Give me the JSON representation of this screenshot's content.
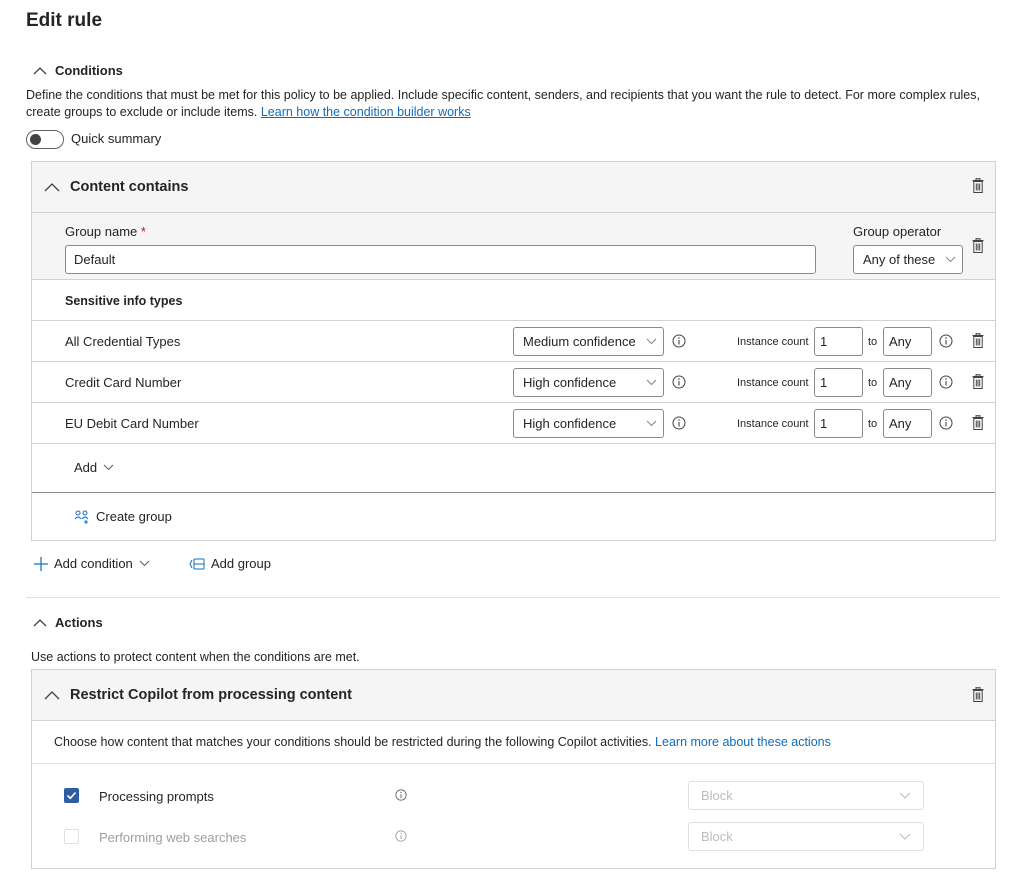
{
  "page": {
    "title": "Edit rule"
  },
  "conditions": {
    "heading": "Conditions",
    "description": "Define the conditions that must be met for this policy to be applied. Include specific content, senders, and recipients that you want the rule to detect. For more complex rules, create groups to exclude or include items.",
    "learn_link": "Learn how the condition builder works",
    "quick_summary_label": "Quick summary",
    "content_card": {
      "title": "Content contains",
      "group_name_label": "Group name",
      "required_mark": "*",
      "group_name_value": "Default",
      "group_operator_label": "Group operator",
      "group_operator_value": "Any of these",
      "sit_heading": "Sensitive info types",
      "instance_label": "Instance count",
      "to_label": "to",
      "rows": [
        {
          "name": "All Credential Types",
          "confidence": "Medium confidence",
          "min": "1",
          "max": "Any"
        },
        {
          "name": "Credit Card Number",
          "confidence": "High confidence",
          "min": "1",
          "max": "Any"
        },
        {
          "name": "EU Debit Card Number",
          "confidence": "High confidence",
          "min": "1",
          "max": "Any"
        }
      ],
      "add_label": "Add",
      "create_group_label": "Create group"
    },
    "add_condition_label": "Add condition",
    "add_group_label": "Add group"
  },
  "actions": {
    "heading": "Actions",
    "description": "Use actions to protect content when the conditions are met.",
    "copilot_card": {
      "title": "Restrict Copilot from processing content",
      "description": "Choose how content that matches your conditions should be restricted during the following Copilot activities.",
      "learn_link": "Learn more about these actions",
      "items": [
        {
          "label": "Processing prompts",
          "checked": true,
          "action": "Block"
        },
        {
          "label": "Performing web searches",
          "checked": false,
          "action": "Block"
        }
      ]
    }
  },
  "colors": {
    "accent": "#0f6cbd",
    "checkbox": "#2f5da3",
    "required": "#c50f1f"
  }
}
